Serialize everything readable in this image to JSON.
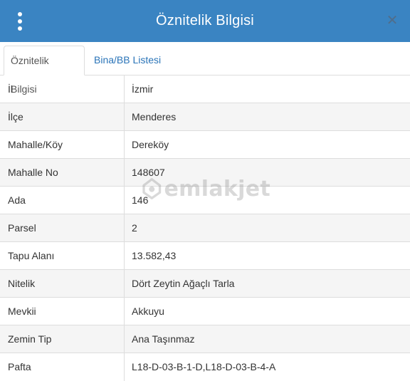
{
  "header": {
    "title": "Öznitelik Bilgisi",
    "menu_icon": "vertical-ellipsis-icon",
    "close_icon": "close-icon",
    "background_color": "#3a84c2"
  },
  "tabs": [
    {
      "label": "Öznitelik Bilgisi",
      "active": true
    },
    {
      "label": "Bina/BB Listesi",
      "active": false
    }
  ],
  "attributes": [
    {
      "key": "İl",
      "value": "İzmir"
    },
    {
      "key": "İlçe",
      "value": "Menderes"
    },
    {
      "key": "Mahalle/Köy",
      "value": "Dereköy"
    },
    {
      "key": "Mahalle No",
      "value": "148607"
    },
    {
      "key": "Ada",
      "value": "146"
    },
    {
      "key": "Parsel",
      "value": "2"
    },
    {
      "key": "Tapu Alanı",
      "value": "13.582,43"
    },
    {
      "key": "Nitelik",
      "value": "Dört Zeytin Ağaçlı Tarla"
    },
    {
      "key": "Mevkii",
      "value": "Akkuyu"
    },
    {
      "key": "Zemin Tip",
      "value": "Ana Taşınmaz"
    },
    {
      "key": "Pafta",
      "value": "L18-D-03-B-1-D,L18-D-03-B-4-A"
    }
  ],
  "watermark": {
    "text": "emlakjet",
    "icon": "house-pin-logo-icon"
  }
}
